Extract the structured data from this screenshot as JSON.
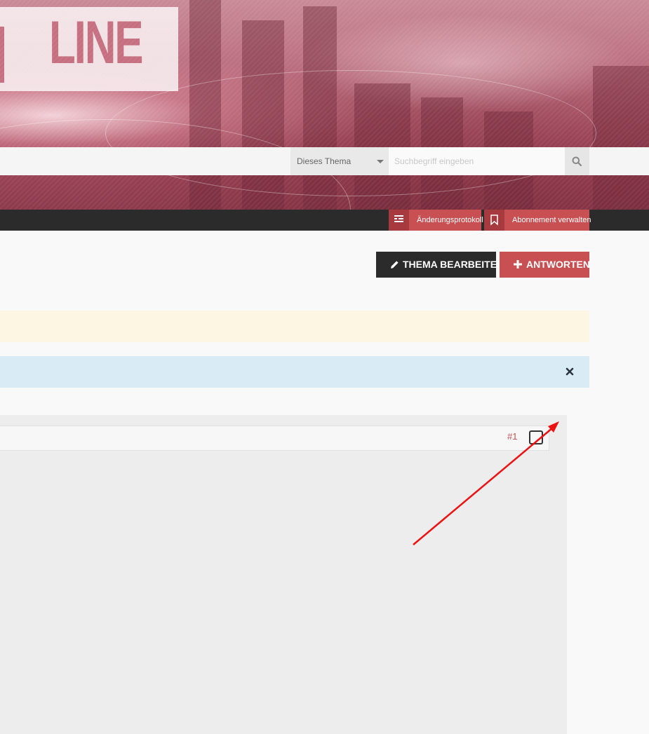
{
  "header": {
    "logo_text": "LINE",
    "search": {
      "scope_label": "Dieses Thema",
      "placeholder": "Suchbegriff eingeben",
      "icon": "search-icon"
    }
  },
  "topbar": {
    "changelog_label": "Änderungsprotokoll",
    "changelog_icon": "list-icon",
    "subscription_label": "Abonnement verwalten",
    "subscription_icon": "bookmark-icon"
  },
  "actions": {
    "edit_label": "Thema bearbeiten",
    "edit_icon": "pencil-icon",
    "reply_label": "Antworten",
    "reply_icon": "plus-icon"
  },
  "notice": {
    "close_icon": "close-icon"
  },
  "post": {
    "number": "#1"
  },
  "colors": {
    "accent": "#c85052",
    "dark": "#2b2b2b",
    "notice_yellow": "#fdf6e3",
    "notice_blue": "#d9ebf5",
    "annotation_arrow": "#ee1111"
  }
}
